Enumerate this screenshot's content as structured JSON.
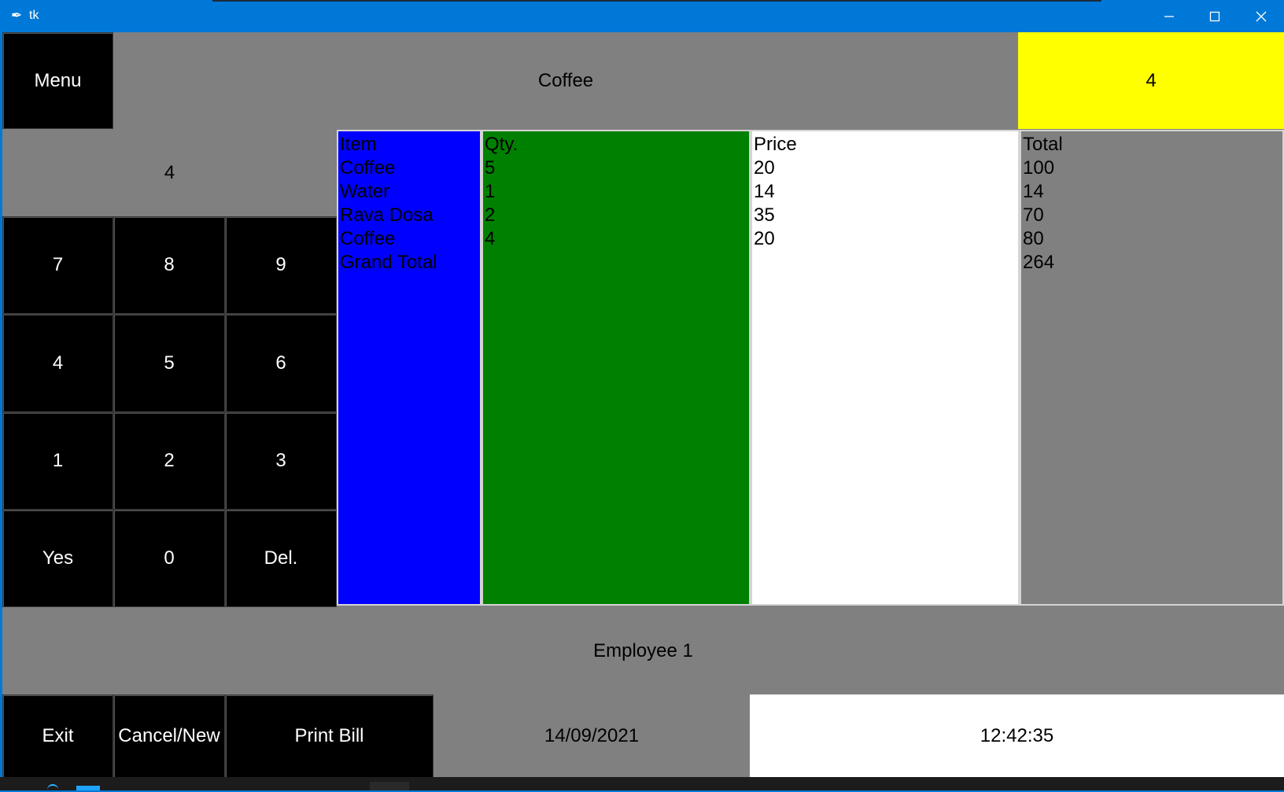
{
  "window": {
    "title": "tk"
  },
  "header": {
    "menu_label": "Menu",
    "current_item": "Coffee",
    "current_qty": "4"
  },
  "keypad": {
    "display": "4",
    "keys": [
      "7",
      "8",
      "9",
      "4",
      "5",
      "6",
      "1",
      "2",
      "3",
      "Yes",
      "0",
      "Del."
    ]
  },
  "bill": {
    "headers": {
      "item": "Item",
      "qty": "Qty.",
      "price": "Price",
      "total": "Total"
    },
    "items": [
      "Coffee",
      "Water",
      "Rava Dosa",
      "Coffee",
      "Grand Total"
    ],
    "qty": [
      "5",
      "1",
      "2",
      "4"
    ],
    "price": [
      "20",
      "14",
      "35",
      "20"
    ],
    "total": [
      "100",
      "14",
      "70",
      "80",
      "264"
    ]
  },
  "footer": {
    "employee": "Employee 1",
    "exit_label": "Exit",
    "cancel_label": "Cancel/New",
    "print_label": "Print Bill",
    "date": "14/09/2021",
    "time": "12:42:35"
  },
  "colors": {
    "background": "#808080",
    "button": "#000000",
    "qty_highlight": "#ffff00",
    "item_column": "#0000ff",
    "qty_column": "#008000",
    "price_column": "#ffffff",
    "total_column": "#808080"
  },
  "icons": [
    "feather-icon",
    "minimize-icon",
    "maximize-icon",
    "close-icon"
  ]
}
